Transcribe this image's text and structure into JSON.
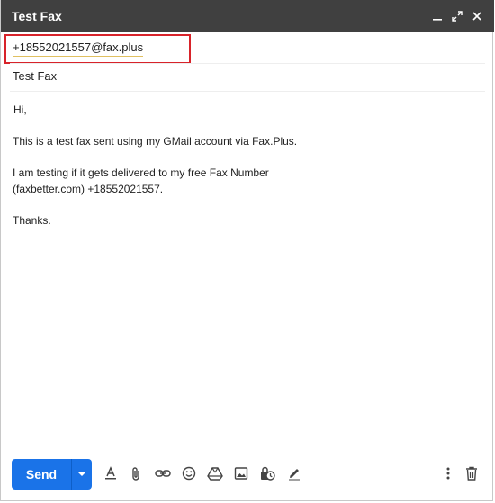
{
  "window": {
    "title": "Test Fax",
    "controls": [
      "minimize-icon",
      "expand-icon",
      "close-icon"
    ]
  },
  "recipient": {
    "address": "+18552021557@fax.plus"
  },
  "subject": {
    "value": "Test Fax"
  },
  "message": {
    "greeting": "Hi,",
    "line1": "This is a test fax sent using my GMail account via Fax.Plus.",
    "line2": "I am testing if it gets delivered to my free Fax Number",
    "line3": "(faxbetter.com) +18552021557.",
    "closing": "Thanks."
  },
  "toolbar": {
    "send_label": "Send",
    "icons": [
      "formatting-icon",
      "attach-icon",
      "link-icon",
      "emoji-icon",
      "drive-icon",
      "photo-icon",
      "confidential-icon",
      "signature-icon",
      "more-options-icon",
      "discard-icon"
    ]
  },
  "colors": {
    "titlebar": "#404040",
    "send_button": "#1a73e8",
    "highlight_border": "#d8232a"
  }
}
